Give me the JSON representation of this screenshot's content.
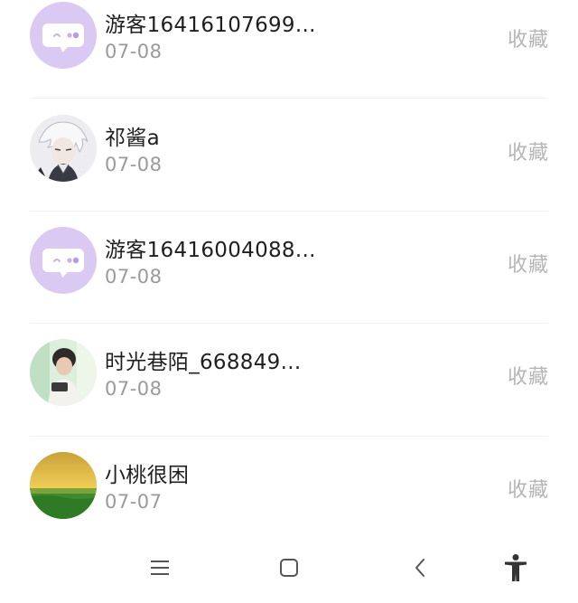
{
  "list": {
    "items": [
      {
        "name": "游客16416107699...",
        "date": "07-08",
        "action": "收藏",
        "avatar": "default-chat-avatar"
      },
      {
        "name": "祁酱a",
        "date": "07-08",
        "action": "收藏",
        "avatar": "anime-character-avatar"
      },
      {
        "name": "游客16416004088...",
        "date": "07-08",
        "action": "收藏",
        "avatar": "default-chat-avatar"
      },
      {
        "name": "时光巷陌_668849...",
        "date": "07-08",
        "action": "收藏",
        "avatar": "photo-person-avatar"
      },
      {
        "name": "小桃很困",
        "date": "07-07",
        "action": "收藏",
        "avatar": "landscape-avatar"
      }
    ]
  },
  "navbar": {
    "icons": [
      "menu-icon",
      "home-square-icon",
      "back-chevron-icon",
      "accessibility-icon"
    ]
  },
  "colors": {
    "default_avatar_bg": "#d9c9f3",
    "action_text": "#b5b5b5",
    "date_text": "#9a9a9a"
  }
}
